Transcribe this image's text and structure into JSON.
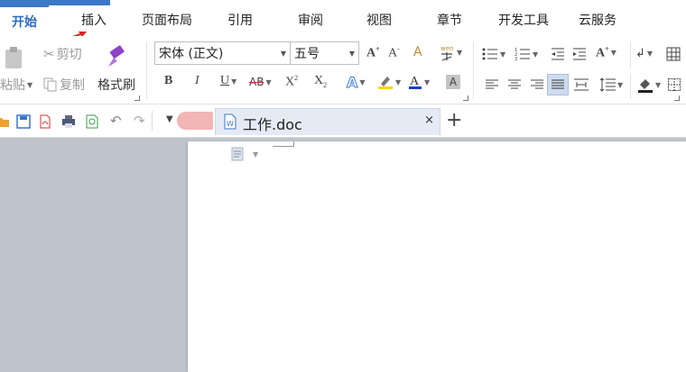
{
  "tabs": [
    "开始",
    "插入",
    "页面布局",
    "引用",
    "审阅",
    "视图",
    "章节",
    "开发工具",
    "云服务"
  ],
  "colors": {
    "accent": "#3c78c8",
    "active_tab_text": "#2a6bc2",
    "workspace": "#bfc3cc",
    "annotation_arrow": "#e02020"
  },
  "ribbon": {
    "paste_label": "粘贴",
    "cut_label": "剪切",
    "copy_label": "复制",
    "format_painter_label": "格式刷",
    "font_name": "宋体 (正文)",
    "font_size": "五号"
  },
  "document": {
    "tab_title": "工作.doc",
    "close_glyph": "×",
    "new_tab_glyph": "+"
  }
}
